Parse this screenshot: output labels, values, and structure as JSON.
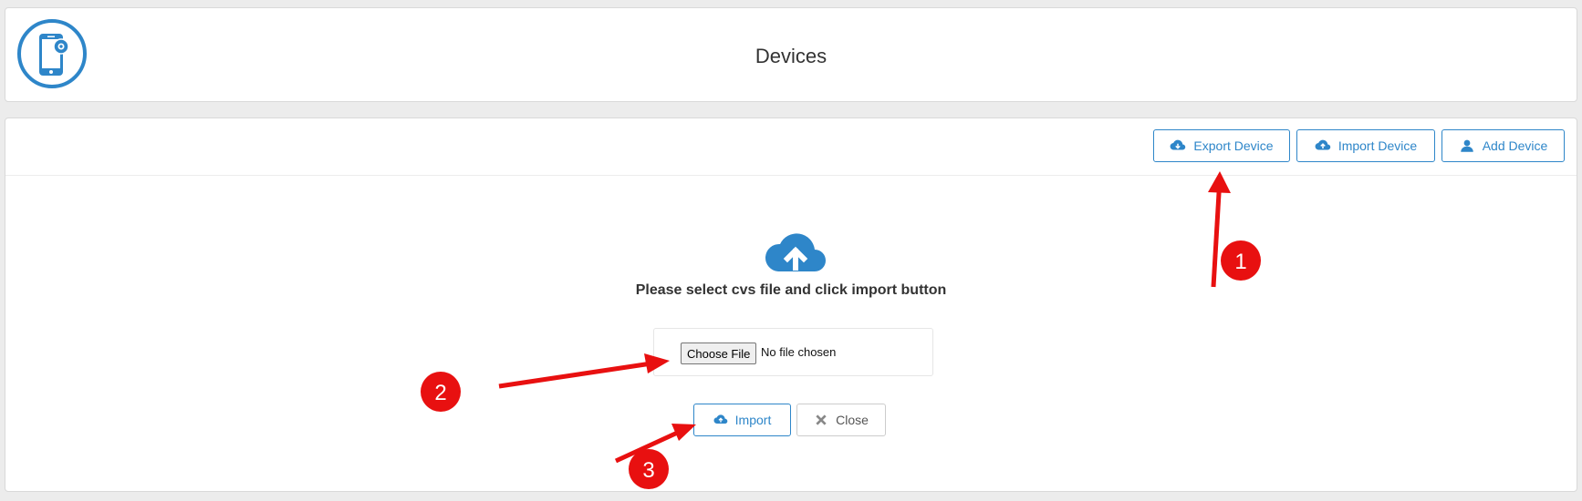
{
  "header": {
    "title": "Devices",
    "logo_icon": "phone-settings-icon"
  },
  "toolbar": {
    "export_label": "Export Device",
    "import_label": "Import Device",
    "add_label": "Add Device"
  },
  "upload": {
    "prompt": "Please select cvs file and click import button",
    "choose_file_label": "Choose File",
    "file_status": "No file chosen",
    "import_label": "Import",
    "close_label": "Close"
  },
  "annotations": {
    "badge1": "1",
    "badge2": "2",
    "badge3": "3"
  },
  "colors": {
    "accent": "#2e86c9",
    "annotation": "#e81010"
  }
}
